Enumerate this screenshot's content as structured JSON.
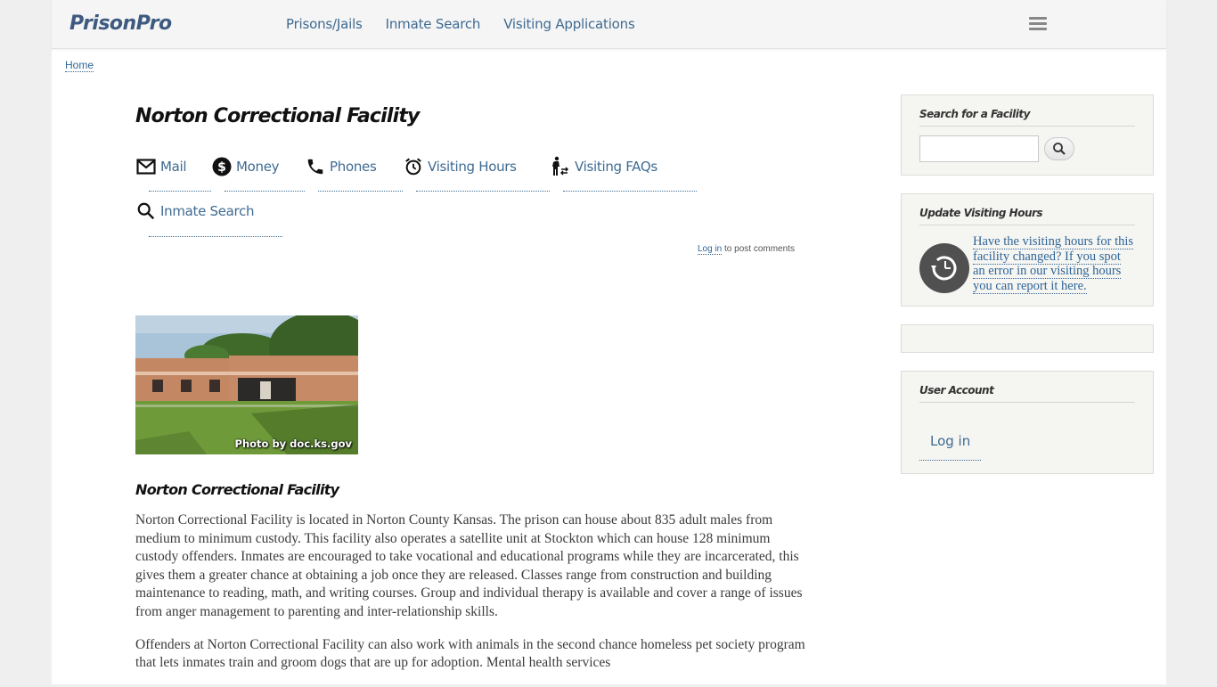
{
  "header": {
    "logo": "PrisonPro",
    "nav": [
      {
        "label": "Prisons/Jails"
      },
      {
        "label": "Inmate Search"
      },
      {
        "label": "Visiting Applications"
      }
    ],
    "menu_icon": "hamburger-menu-icon"
  },
  "breadcrumb": {
    "home": "Home"
  },
  "main": {
    "title": "Norton Correctional Facility",
    "tabs": [
      {
        "label": "Mail",
        "icon": "mail-icon"
      },
      {
        "label": "Money",
        "icon": "dollar-icon"
      },
      {
        "label": "Phones",
        "icon": "phone-icon"
      },
      {
        "label": "Visiting Hours",
        "icon": "alarm-clock-icon"
      },
      {
        "label": "Visiting FAQs",
        "icon": "person-walking-icon"
      },
      {
        "label": "Inmate Search",
        "icon": "search-icon"
      }
    ],
    "comments": {
      "login_link": "Log in",
      "suffix": " to post comments"
    },
    "photo_caption": "Photo by doc.ks.gov",
    "subtitle": "Norton Correctional Facility",
    "paragraphs": [
      "Norton Correctional Facility is located in Norton County Kansas.  The prison can house about 835 adult males from medium to minimum custody.  This facility also operates a satellite unit at Stockton which can house 128 minimum custody offenders.  Inmates are encouraged to take vocational and educational programs while they are incarcerated, this gives them a greater chance at obtaining a job once they are released.  Classes range from construction and building maintenance to reading, math, and writing courses.  Group and individual therapy is available and cover a range of issues from anger management to parenting and inter-relationship skills.",
      "Offenders at Norton Correctional Facility can also work with animals in the second chance homeless pet society program that lets inmates train and groom dogs that are up for adoption.  Mental health services"
    ]
  },
  "sidebar": {
    "search": {
      "title": "Search for a Facility",
      "value": "",
      "placeholder": ""
    },
    "update_hours": {
      "title": "Update Visiting Hours",
      "link_text": "Have the visiting hours for this facility changed?  If you spot an error in our visiting hours you can report it here."
    },
    "user_account": {
      "title": "User Account",
      "login": "Log in"
    }
  }
}
